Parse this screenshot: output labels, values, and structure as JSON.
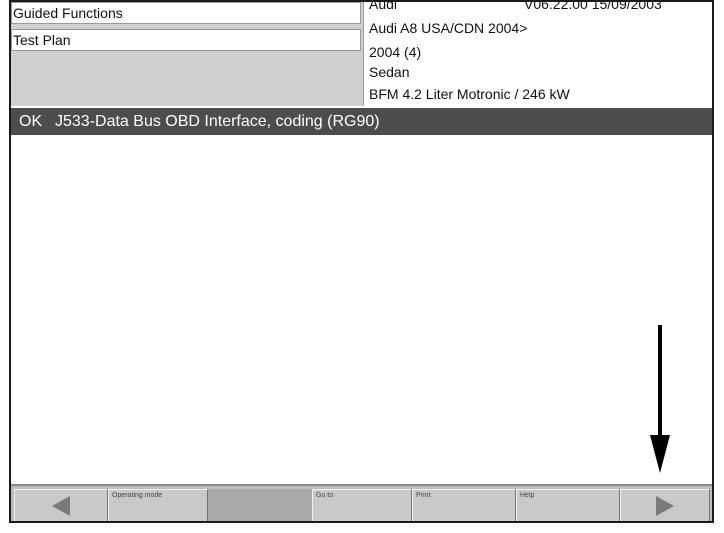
{
  "header": {
    "guided_functions": "Guided Functions",
    "test_plan": "Test Plan",
    "make": "Audi",
    "version": "V06.22.00 15/09/2003",
    "model": "Audi A8 USA/CDN 2004>",
    "model_year": "2004 (4)",
    "body_style": "Sedan",
    "engine": "BFM 4.2 Liter Motronic / 246 kW"
  },
  "result": {
    "status": "OK",
    "text": "J533-Data Bus OBD Interface, coding (RG90)"
  },
  "toolbar": {
    "back_icon": "left-arrow-icon",
    "operating_mode": "Operating mode",
    "go_to": "Go to",
    "print": "Print",
    "help": "Help",
    "forward_icon": "right-arrow-icon"
  },
  "colors": {
    "result_bar": "#4d4d4d",
    "toolbar": "#bdbdbd",
    "header_left_bg": "#cfcfcf",
    "arrow_icons": "#7a7a7a"
  }
}
